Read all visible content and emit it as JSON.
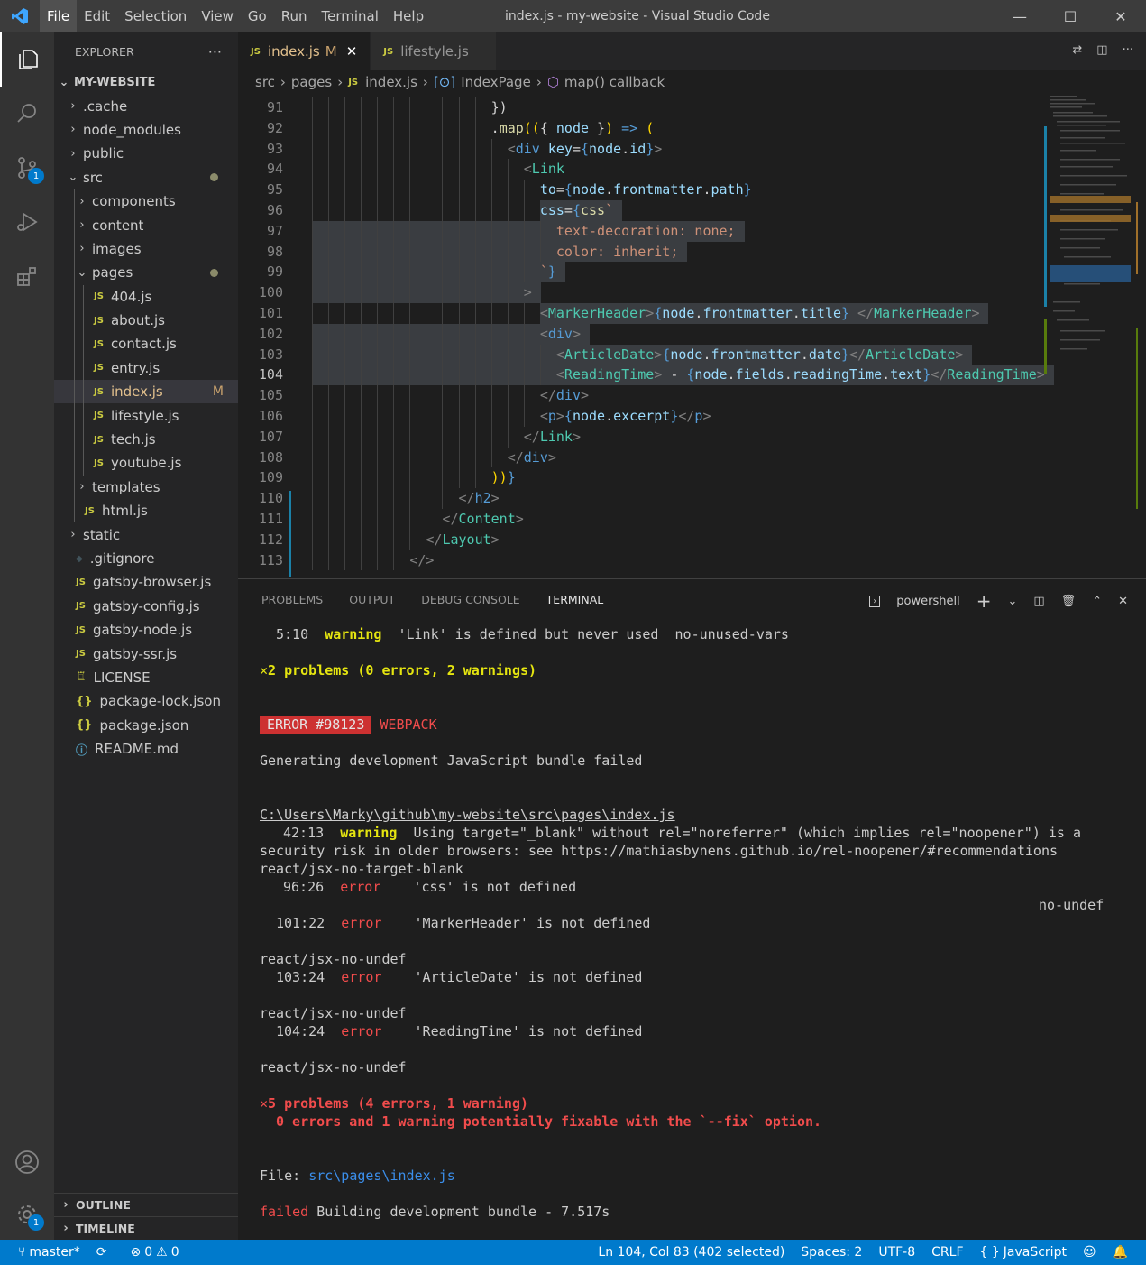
{
  "window": {
    "title": "index.js - my-website - Visual Studio Code",
    "menu": [
      "File",
      "Edit",
      "Selection",
      "View",
      "Go",
      "Run",
      "Terminal",
      "Help"
    ]
  },
  "activity": {
    "source_control_badge": "1",
    "settings_badge": "1"
  },
  "sidebar": {
    "header": "EXPLORER",
    "more": "···",
    "root": "MY-WEBSITE",
    "items": [
      {
        "label": ".cache",
        "type": "folder",
        "depth": 1
      },
      {
        "label": "node_modules",
        "type": "folder",
        "depth": 1
      },
      {
        "label": "public",
        "type": "folder",
        "depth": 1
      },
      {
        "label": "src",
        "type": "folder-open",
        "depth": 1,
        "dot": true
      },
      {
        "label": "components",
        "type": "folder",
        "depth": 2
      },
      {
        "label": "content",
        "type": "folder",
        "depth": 2
      },
      {
        "label": "images",
        "type": "folder",
        "depth": 2
      },
      {
        "label": "pages",
        "type": "folder-open",
        "depth": 2,
        "dot": true
      },
      {
        "label": "404.js",
        "type": "js",
        "depth": 3
      },
      {
        "label": "about.js",
        "type": "js",
        "depth": 3
      },
      {
        "label": "contact.js",
        "type": "js",
        "depth": 3
      },
      {
        "label": "entry.js",
        "type": "js",
        "depth": 3
      },
      {
        "label": "index.js",
        "type": "js",
        "depth": 3,
        "selected": true,
        "flag": "M"
      },
      {
        "label": "lifestyle.js",
        "type": "js",
        "depth": 3
      },
      {
        "label": "tech.js",
        "type": "js",
        "depth": 3
      },
      {
        "label": "youtube.js",
        "type": "js",
        "depth": 3
      },
      {
        "label": "templates",
        "type": "folder",
        "depth": 2
      },
      {
        "label": "html.js",
        "type": "js",
        "depth": 2
      },
      {
        "label": "static",
        "type": "folder",
        "depth": 1
      },
      {
        "label": ".gitignore",
        "type": "git",
        "depth": 1
      },
      {
        "label": "gatsby-browser.js",
        "type": "js",
        "depth": 1
      },
      {
        "label": "gatsby-config.js",
        "type": "js",
        "depth": 1
      },
      {
        "label": "gatsby-node.js",
        "type": "js",
        "depth": 1
      },
      {
        "label": "gatsby-ssr.js",
        "type": "js",
        "depth": 1
      },
      {
        "label": "LICENSE",
        "type": "license",
        "depth": 1
      },
      {
        "label": "package-lock.json",
        "type": "json",
        "depth": 1
      },
      {
        "label": "package.json",
        "type": "json",
        "depth": 1
      },
      {
        "label": "README.md",
        "type": "info",
        "depth": 1
      }
    ],
    "outline": "OUTLINE",
    "timeline": "TIMELINE"
  },
  "tabs": [
    {
      "label": "index.js",
      "flag": "M",
      "active": true
    },
    {
      "label": "lifestyle.js",
      "active": false
    }
  ],
  "breadcrumb": [
    "src",
    "pages",
    "index.js",
    "IndexPage",
    "map() callback"
  ],
  "editor": {
    "lines": [
      {
        "n": "91",
        "tokens": [
          [
            "pun",
            "})"
          ]
        ],
        "ind": 11
      },
      {
        "n": "92",
        "tokens": [
          [
            "pun",
            "."
          ],
          [
            "fn",
            "map"
          ],
          [
            "y",
            "(("
          ],
          [
            "pun",
            "{ "
          ],
          [
            "v",
            "node"
          ],
          [
            "pun",
            " }"
          ],
          [
            "y",
            ")"
          ],
          [
            "tag",
            " =>"
          ],
          [
            "y",
            " ("
          ]
        ],
        "ind": 11
      },
      {
        "n": "93",
        "tokens": [
          [
            "br",
            "<"
          ],
          [
            "tag",
            "div"
          ],
          [
            "attr",
            " key"
          ],
          [
            "pun",
            "="
          ],
          [
            "tag",
            "{"
          ],
          [
            "v",
            "node"
          ],
          [
            "pun",
            "."
          ],
          [
            "v",
            "id"
          ],
          [
            "tag",
            "}"
          ],
          [
            "br",
            ">"
          ]
        ],
        "ind": 12
      },
      {
        "n": "94",
        "tokens": [
          [
            "br",
            "<"
          ],
          [
            "cmp",
            "Link"
          ]
        ],
        "ind": 13
      },
      {
        "n": "95",
        "tokens": [
          [
            "attr",
            "to"
          ],
          [
            "pun",
            "="
          ],
          [
            "tag",
            "{"
          ],
          [
            "v",
            "node"
          ],
          [
            "pun",
            "."
          ],
          [
            "v",
            "frontmatter"
          ],
          [
            "pun",
            "."
          ],
          [
            "v",
            "path"
          ],
          [
            "tag",
            "}"
          ]
        ],
        "ind": 14
      },
      {
        "n": "96",
        "tokens": [
          [
            "attr",
            "css"
          ],
          [
            "pun",
            "="
          ],
          [
            "tag",
            "{"
          ],
          [
            "fn",
            "css"
          ],
          [
            "str",
            "`"
          ]
        ],
        "ind": 14
      },
      {
        "n": "97",
        "tokens": [
          [
            "str",
            "text-decoration: none;"
          ]
        ],
        "ind": 15
      },
      {
        "n": "98",
        "tokens": [
          [
            "str",
            "color: inherit;"
          ]
        ],
        "ind": 15
      },
      {
        "n": "99",
        "tokens": [
          [
            "str",
            "`"
          ],
          [
            "tag",
            "}"
          ]
        ],
        "ind": 14
      },
      {
        "n": "100",
        "tokens": [
          [
            "br",
            ">"
          ]
        ],
        "ind": 13
      },
      {
        "n": "101",
        "tokens": [
          [
            "br",
            "<"
          ],
          [
            "cmp",
            "MarkerHeader"
          ],
          [
            "br",
            ">"
          ],
          [
            "tag",
            "{"
          ],
          [
            "v",
            "node"
          ],
          [
            "pun",
            "."
          ],
          [
            "v",
            "frontmatter"
          ],
          [
            "pun",
            "."
          ],
          [
            "v",
            "title"
          ],
          [
            "tag",
            "}"
          ],
          [
            "pun",
            " "
          ],
          [
            "br",
            "</"
          ],
          [
            "cmp",
            "MarkerHeader"
          ],
          [
            "br",
            ">"
          ]
        ],
        "ind": 14
      },
      {
        "n": "102",
        "tokens": [
          [
            "br",
            "<"
          ],
          [
            "tag",
            "div"
          ],
          [
            "br",
            ">"
          ]
        ],
        "ind": 14
      },
      {
        "n": "103",
        "tokens": [
          [
            "br",
            "<"
          ],
          [
            "cmp",
            "ArticleDate"
          ],
          [
            "br",
            ">"
          ],
          [
            "tag",
            "{"
          ],
          [
            "v",
            "node"
          ],
          [
            "pun",
            "."
          ],
          [
            "v",
            "frontmatter"
          ],
          [
            "pun",
            "."
          ],
          [
            "v",
            "date"
          ],
          [
            "tag",
            "}"
          ],
          [
            "br",
            "</"
          ],
          [
            "cmp",
            "ArticleDate"
          ],
          [
            "br",
            ">"
          ]
        ],
        "ind": 15
      },
      {
        "n": "104",
        "tokens": [
          [
            "br",
            "<"
          ],
          [
            "cmp",
            "ReadingTime"
          ],
          [
            "br",
            ">"
          ],
          [
            "pun",
            " - "
          ],
          [
            "tag",
            "{"
          ],
          [
            "v",
            "node"
          ],
          [
            "pun",
            "."
          ],
          [
            "v",
            "fields"
          ],
          [
            "pun",
            "."
          ],
          [
            "v",
            "readingTime"
          ],
          [
            "pun",
            "."
          ],
          [
            "v",
            "text"
          ],
          [
            "tag",
            "}"
          ],
          [
            "br",
            "</"
          ],
          [
            "cmp",
            "ReadingTime"
          ],
          [
            "br",
            ">"
          ]
        ],
        "ind": 15
      },
      {
        "n": "105",
        "tokens": [
          [
            "br",
            "</"
          ],
          [
            "tag",
            "div"
          ],
          [
            "br",
            ">"
          ]
        ],
        "ind": 14
      },
      {
        "n": "106",
        "tokens": [
          [
            "br",
            "<"
          ],
          [
            "tag",
            "p"
          ],
          [
            "br",
            ">"
          ],
          [
            "tag",
            "{"
          ],
          [
            "v",
            "node"
          ],
          [
            "pun",
            "."
          ],
          [
            "v",
            "excerpt"
          ],
          [
            "tag",
            "}"
          ],
          [
            "br",
            "</"
          ],
          [
            "tag",
            "p"
          ],
          [
            "br",
            ">"
          ]
        ],
        "ind": 14
      },
      {
        "n": "107",
        "tokens": [
          [
            "br",
            "</"
          ],
          [
            "cmp",
            "Link"
          ],
          [
            "br",
            ">"
          ]
        ],
        "ind": 13
      },
      {
        "n": "108",
        "tokens": [
          [
            "br",
            "</"
          ],
          [
            "tag",
            "div"
          ],
          [
            "br",
            ">"
          ]
        ],
        "ind": 12
      },
      {
        "n": "109",
        "tokens": [
          [
            "y",
            "))"
          ],
          [
            "tag",
            "}"
          ]
        ],
        "ind": 11
      },
      {
        "n": "110",
        "tokens": [
          [
            "br",
            "</"
          ],
          [
            "tag",
            "h2"
          ],
          [
            "br",
            ">"
          ]
        ],
        "ind": 9
      },
      {
        "n": "111",
        "tokens": [
          [
            "br",
            "</"
          ],
          [
            "cmp",
            "Content"
          ],
          [
            "br",
            ">"
          ]
        ],
        "ind": 8
      },
      {
        "n": "112",
        "tokens": [
          [
            "br",
            "</"
          ],
          [
            "cmp",
            "Layout"
          ],
          [
            "br",
            ">"
          ]
        ],
        "ind": 7
      },
      {
        "n": "113",
        "tokens": [
          [
            "br",
            "</"
          ],
          [
            "br",
            ">"
          ]
        ],
        "ind": 6
      }
    ],
    "current_line": "104"
  },
  "panel": {
    "tabs": [
      "PROBLEMS",
      "OUTPUT",
      "DEBUG CONSOLE",
      "TERMINAL"
    ],
    "active_tab": "TERMINAL",
    "shell": "powershell",
    "terminal": {
      "l1_pos": "5:10",
      "l1_level": "warning",
      "l1_msg": "'Link' is defined but never used  no-unused-vars",
      "summary1": "✕2 problems (0 errors, 2 warnings)",
      "error_badge": "ERROR #98123",
      "error_source": "WEBPACK",
      "gen_failed": "Generating development JavaScript bundle failed",
      "filepath": "C:\\Users\\Marky\\github\\my-website\\src\\pages\\index.js",
      "w_pos": "42:13",
      "w_level": "warning",
      "w_msg": "Using target=\"_blank\" without rel=\"noreferrer\" (which implies rel=\"noopener\") is a",
      "w_msg2": "security risk in older browsers: see https://mathiasbynens.github.io/rel-noopener/#recommendations",
      "w_rule": "react/jsx-no-target-blank",
      "e1_pos": "96:26",
      "e1_level": "error",
      "e1_msg": "'css' is not defined",
      "e1_rule": "no-undef",
      "e2_pos": "101:22",
      "e2_level": "error",
      "e2_msg": "'MarkerHeader' is not defined",
      "e2_rule": "react/jsx-no-undef",
      "e3_pos": "103:24",
      "e3_level": "error",
      "e3_msg": "'ArticleDate' is not defined",
      "e3_rule": "react/jsx-no-undef",
      "e4_pos": "104:24",
      "e4_level": "error",
      "e4_msg": "'ReadingTime' is not defined",
      "e4_rule": "react/jsx-no-undef",
      "summary2": "✕5 problems (4 errors, 1 warning)",
      "fixable": "0 errors and 1 warning potentially fixable with the `--fix` option.",
      "file_label": "File: ",
      "file_path": "src\\pages\\index.js",
      "failed": "failed",
      "building": " Building development bundle - 7.517s"
    }
  },
  "status": {
    "branch": "master*",
    "errors": "0",
    "warnings": "0",
    "position": "Ln 104, Col 83 (402 selected)",
    "spaces": "Spaces: 2",
    "encoding": "UTF-8",
    "eol": "CRLF",
    "language": "JavaScript",
    "language_icon": "{ }"
  },
  "colors": {
    "statusbar": "#007acc",
    "activitybar": "#333333",
    "sidebar": "#252526",
    "editor": "#1e1e1e"
  }
}
